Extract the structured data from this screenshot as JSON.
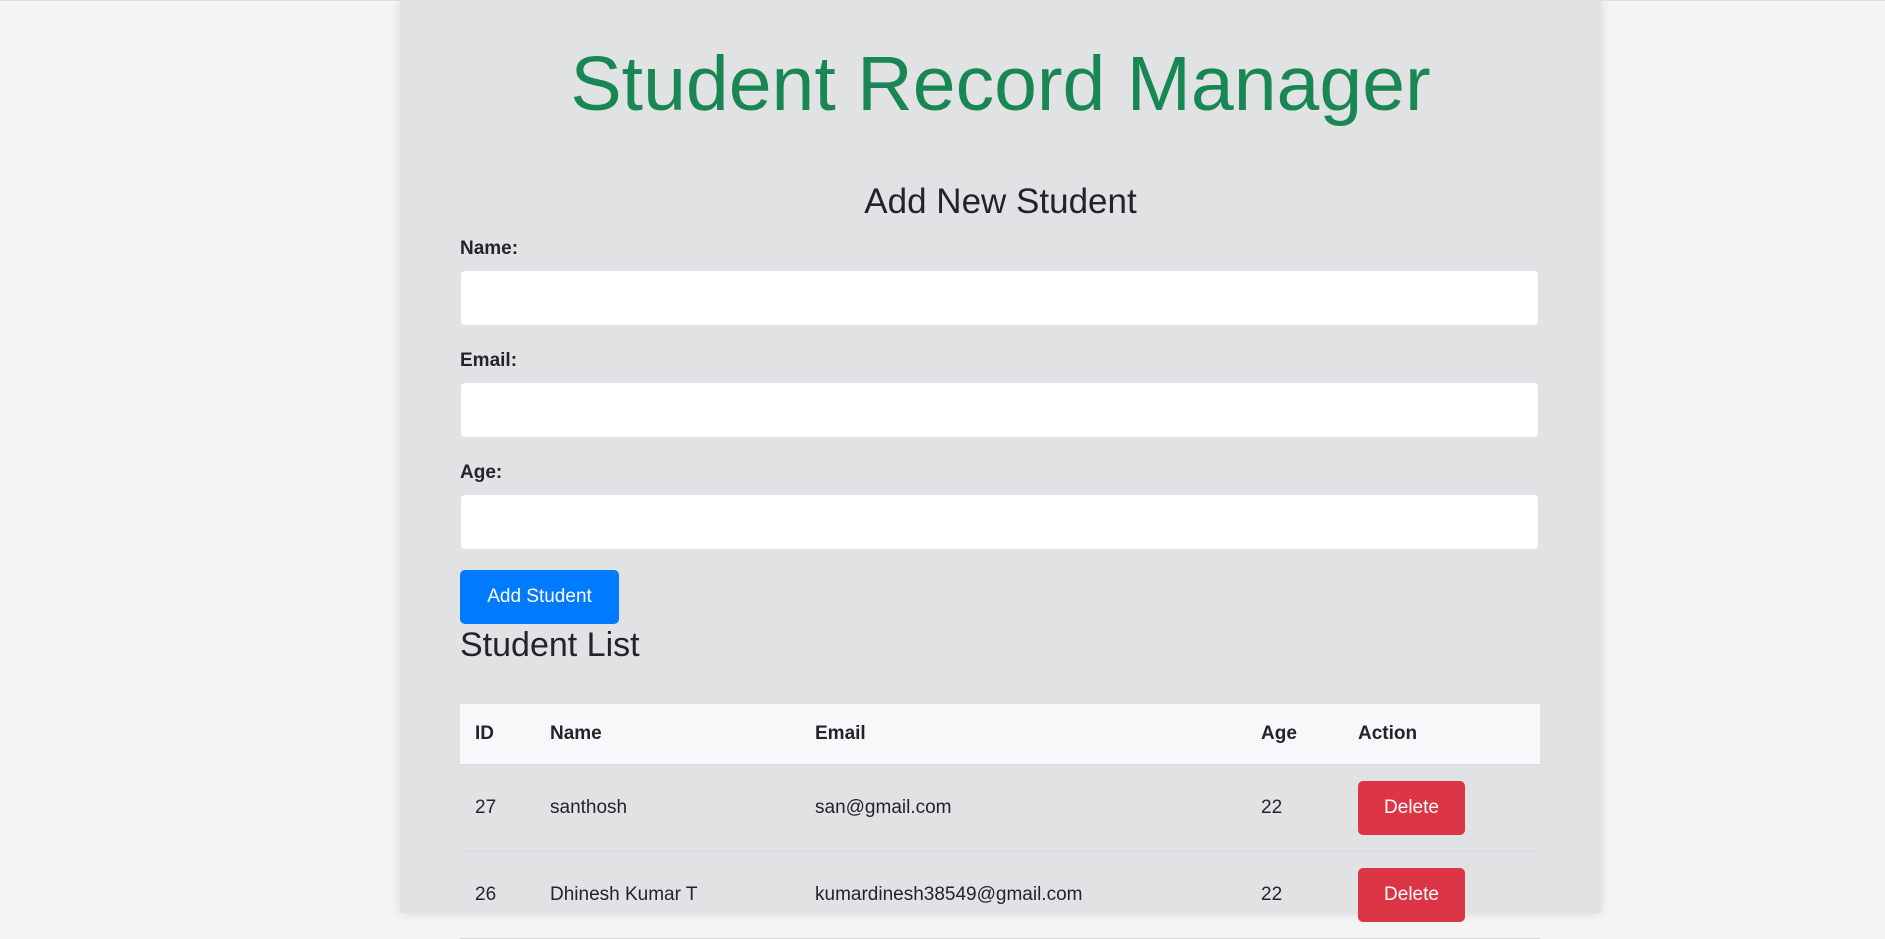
{
  "header": {
    "title": "Student Record Manager"
  },
  "form": {
    "heading": "Add New Student",
    "name_label": "Name:",
    "email_label": "Email:",
    "age_label": "Age:",
    "name_value": "",
    "email_value": "",
    "age_value": "",
    "submit_label": "Add Student"
  },
  "list": {
    "heading": "Student List",
    "columns": [
      "ID",
      "Name",
      "Email",
      "Age",
      "Action"
    ],
    "rows": [
      {
        "id": "27",
        "name": "santhosh",
        "email": "san@gmail.com",
        "age": "22",
        "action": "Delete"
      },
      {
        "id": "26",
        "name": "Dhinesh Kumar T",
        "email": "kumardinesh38549@gmail.com",
        "age": "22",
        "action": "Delete"
      }
    ]
  },
  "colors": {
    "title": "#198754",
    "primary": "#007bff",
    "danger": "#dc3545"
  }
}
